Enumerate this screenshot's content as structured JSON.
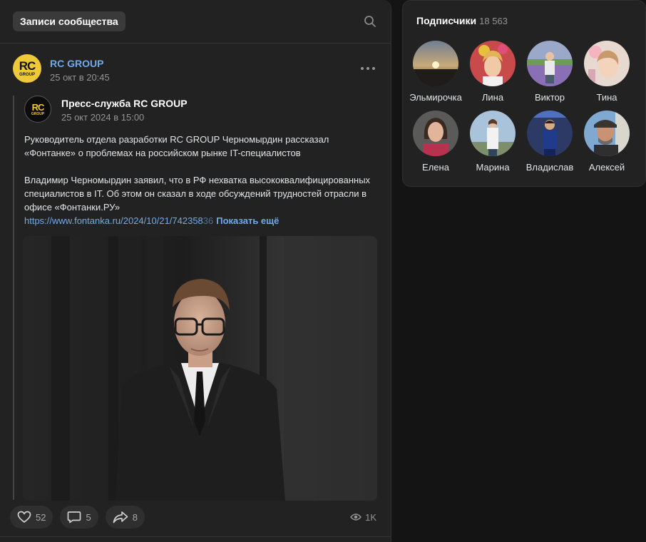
{
  "wall": {
    "header_chip": "Записи сообщества",
    "search_icon": "search-icon"
  },
  "post": {
    "author": "RC GROUP",
    "date": "25 окт в 20:45",
    "logo_text": "RC",
    "logo_sub": "GROUP",
    "repost": {
      "author": "Пресс-служба RC GROUP",
      "date": "25 окт 2024 в 15:00",
      "logo_text": "RC",
      "logo_sub": "GROUP",
      "text_p1": "Руководитель отдела разработки RC GROUP Черномырдин рассказал «Фонтанке» о проблемах на российском рынке IT-специалистов",
      "text_p2": "Владимир Черномырдин заявил, что в РФ нехватка высококвалифицированных специалистов в IT. Об этом он сказал в ходе обсуждений трудностей отрасли в офисе «Фонтанки.РУ»",
      "link": "https://www.fontanka.ru/2024/10/21/742358",
      "link_fade": "36",
      "show_more": "Показать ещё"
    },
    "actions": {
      "likes": "52",
      "comments": "5",
      "shares": "8",
      "views": "1K"
    }
  },
  "subscribers": {
    "title": "Подписчики",
    "count": "18 563",
    "people": [
      {
        "name": "Эльмирочка"
      },
      {
        "name": "Лина"
      },
      {
        "name": "Виктор"
      },
      {
        "name": "Тина"
      },
      {
        "name": "Елена"
      },
      {
        "name": "Марина"
      },
      {
        "name": "Владислав"
      },
      {
        "name": "Алексей"
      }
    ]
  },
  "colors": {
    "accent": "#71aaeb",
    "background": "#141414",
    "card": "#222222",
    "brand_yellow": "#f0c93a"
  }
}
